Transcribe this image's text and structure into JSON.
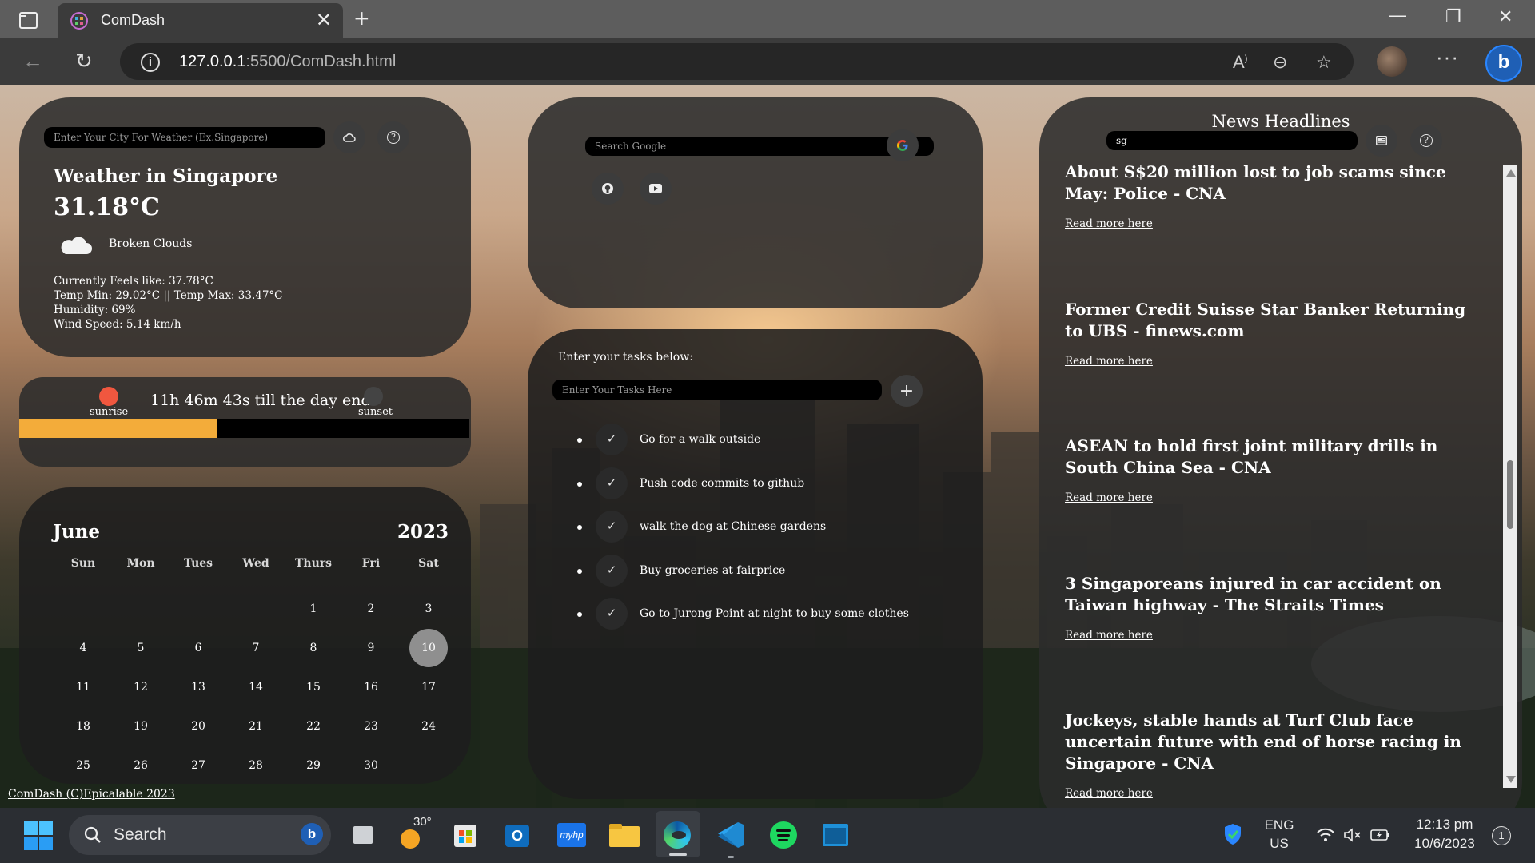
{
  "browser": {
    "tab_title": "ComDash",
    "url_host": "127.0.0.1",
    "url_path": ":5500/ComDash.html"
  },
  "weather": {
    "city_placeholder": "Enter Your City For Weather (Ex.Singapore)",
    "title": "Weather in Singapore",
    "temperature": "31.18°C",
    "description": "Broken Clouds",
    "feels_like": "Currently Feels like: 37.78°C",
    "temp_range": "Temp Min: 29.02°C || Temp Max: 33.47°C",
    "humidity": "Humidity: 69%",
    "wind": "Wind Speed: 5.14 km/h"
  },
  "daylight": {
    "sunrise_label": "sunrise",
    "sunset_label": "sunset",
    "countdown": "11h 46m 43s till the day ends",
    "progress_fraction": 0.44,
    "colors": {
      "sunrise": "#f0573f",
      "sunset": "#444444",
      "bar": "#f3ac3a"
    }
  },
  "calendar": {
    "month": "June",
    "year": "2023",
    "weekdays": [
      "Sun",
      "Mon",
      "Tues",
      "Wed",
      "Thurs",
      "Fri",
      "Sat"
    ],
    "first_weekday_index": 4,
    "days_in_month": 30,
    "today": 10
  },
  "search": {
    "placeholder": "Search Google"
  },
  "tasks": {
    "prompt": "Enter your tasks below:",
    "input_placeholder": "Enter Your Tasks Here",
    "items": [
      "Go for a walk outside",
      "Push code commits to github",
      "walk the dog at Chinese gardens",
      "Buy groceries at fairprice",
      "Go to Jurong Point at night to buy some clothes"
    ]
  },
  "news": {
    "heading": "News Headlines",
    "country_value": "sg",
    "items": [
      {
        "headline": "About S$20 million lost to job scams since May: Police - CNA",
        "link": "Read more here"
      },
      {
        "headline": "Former Credit Suisse Star Banker Returning to UBS - finews.com",
        "link": "Read more here"
      },
      {
        "headline": "ASEAN to hold first joint military drills in South China Sea - CNA",
        "link": "Read more here"
      },
      {
        "headline": "3 Singaporeans injured in car accident on Taiwan highway - The Straits Times",
        "link": "Read more here"
      },
      {
        "headline": "Jockeys, stable hands at Turf Club face uncertain future with end of horse racing in Singapore - CNA",
        "link": "Read more here"
      }
    ]
  },
  "footer": {
    "text": "ComDash (C)Epicalable 2023"
  },
  "taskbar": {
    "search_label": "Search",
    "weather_temp": "30°",
    "lang_line1": "ENG",
    "lang_line2": "US",
    "time": "12:13 pm",
    "date": "10/6/2023",
    "notification_count": "1"
  }
}
